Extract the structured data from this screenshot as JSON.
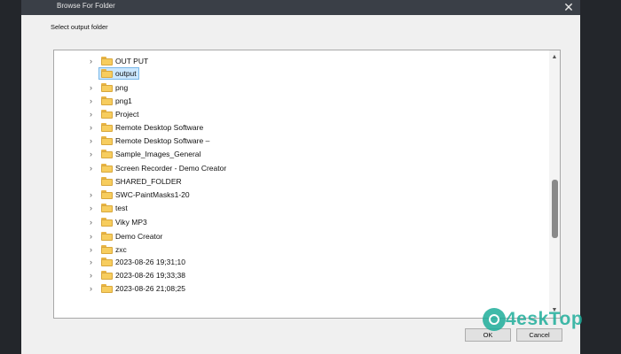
{
  "window": {
    "title": "Browse For Folder",
    "close_glyph": "✕"
  },
  "prompt": "Select output folder",
  "folders": [
    {
      "label": "OUT PUT",
      "expandable": true,
      "selected": false
    },
    {
      "label": "output",
      "expandable": false,
      "selected": true
    },
    {
      "label": "png",
      "expandable": true,
      "selected": false
    },
    {
      "label": "png1",
      "expandable": true,
      "selected": false
    },
    {
      "label": "Project",
      "expandable": true,
      "selected": false
    },
    {
      "label": "Remote Desktop Software",
      "expandable": true,
      "selected": false
    },
    {
      "label": "Remote Desktop Software –",
      "expandable": true,
      "selected": false
    },
    {
      "label": "Sample_Images_General",
      "expandable": true,
      "selected": false
    },
    {
      "label": "Screen Recorder - Demo Creator",
      "expandable": true,
      "selected": false
    },
    {
      "label": "SHARED_FOLDER",
      "expandable": false,
      "selected": false
    },
    {
      "label": "SWC-PaintMasks1-20",
      "expandable": true,
      "selected": false
    },
    {
      "label": "test",
      "expandable": true,
      "selected": false
    },
    {
      "label": "Viky MP3",
      "expandable": true,
      "selected": false
    },
    {
      "label": "Demo Creator",
      "expandable": true,
      "selected": false
    },
    {
      "label": "zxc",
      "expandable": true,
      "selected": false
    },
    {
      "label": "2023-08-26 19;31;10",
      "expandable": true,
      "selected": false
    },
    {
      "label": "2023-08-26 19;33;38",
      "expandable": true,
      "selected": false
    },
    {
      "label": "2023-08-26 21;08;25",
      "expandable": true,
      "selected": false
    }
  ],
  "buttons": {
    "ok": "OK",
    "cancel": "Cancel"
  },
  "watermark": "4eskTop",
  "icons": {
    "expand": "chevron-right-icon",
    "folder": "folder-icon",
    "scroll_up": "chevron-up-icon",
    "scroll_down": "chevron-down-icon"
  },
  "colors": {
    "titlebar": "#3a3f47",
    "folder": "#f7cd5e",
    "selection": "#cce8ff",
    "watermark": "#1fae9b"
  }
}
